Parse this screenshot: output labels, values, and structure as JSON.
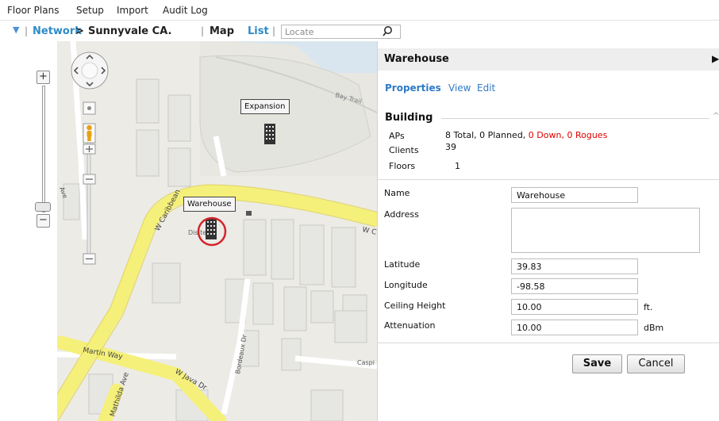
{
  "menu": {
    "items": [
      "Floor Plans",
      "Setup",
      "Import",
      "Audit Log"
    ]
  },
  "breadcrumb": {
    "network": "Network",
    "separator": ">",
    "site": "Sunnyvale CA.",
    "map": "Map",
    "list": "List",
    "locate_placeholder": "Locate"
  },
  "zoom": {
    "plus": "+",
    "minus": "−"
  },
  "map": {
    "labels": {
      "expansion": "Expansion",
      "warehouse": "Warehouse"
    },
    "streets": {
      "bay_trail": "Bay Trail",
      "w_caribbean": "W Caribbean",
      "ave": "Ave",
      "w_c": "W C",
      "martin_way": "Martin Way",
      "w_java_dr": "W Java Dr",
      "bordeaux_dr": "Bordeaux Dr",
      "caspi": "Caspi",
      "mathilda_ave": "Mathilda Ave",
      "dist_label": "Dis    ter"
    }
  },
  "panel": {
    "title": "Warehouse",
    "tabs": [
      "Properties",
      "View",
      "Edit"
    ],
    "section_title": "Building",
    "aps_label": "APs",
    "aps_total": "8 Total, 0 Planned, ",
    "aps_down": "0 Down, ",
    "aps_rogues": "0 Rogues",
    "clients_label": "Clients",
    "clients_value": "39",
    "floors_label": "Floors",
    "floors_value": "1",
    "fields": {
      "name": {
        "label": "Name",
        "value": "Warehouse"
      },
      "address": {
        "label": "Address",
        "value": ""
      },
      "latitude": {
        "label": "Latitude",
        "value": "39.83"
      },
      "longitude": {
        "label": "Longitude",
        "value": "-98.58"
      },
      "ceiling_height": {
        "label": "Ceiling Height",
        "value": "10.00",
        "unit": "ft."
      },
      "attenuation": {
        "label": "Attenuation",
        "value": "10.00",
        "unit": "dBm"
      }
    },
    "save_label": "Save",
    "cancel_label": "Cancel"
  }
}
